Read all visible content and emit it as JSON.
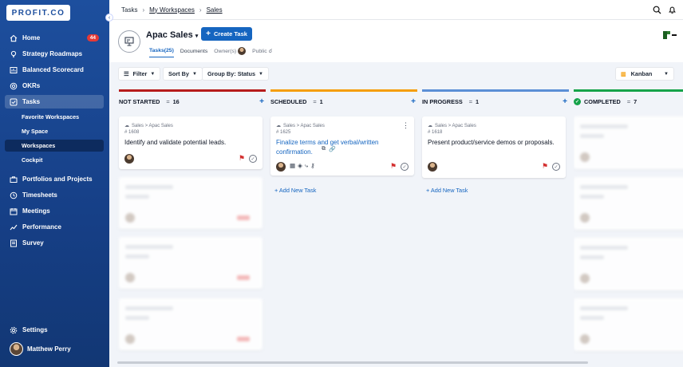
{
  "sidebar": {
    "logo": "PROFIT.CO",
    "items": [
      {
        "label": "Home",
        "icon": "home-icon",
        "badge": "44"
      },
      {
        "label": "Strategy Roadmaps",
        "icon": "bulb-icon"
      },
      {
        "label": "Balanced Scorecard",
        "icon": "scorecard-icon"
      },
      {
        "label": "OKRs",
        "icon": "target-icon"
      },
      {
        "label": "Tasks",
        "icon": "checkbox-icon"
      },
      {
        "label": "Portfolios and Projects",
        "icon": "briefcase-icon"
      },
      {
        "label": "Timesheets",
        "icon": "clock-icon"
      },
      {
        "label": "Meetings",
        "icon": "calendar-icon"
      },
      {
        "label": "Performance",
        "icon": "performance-icon"
      },
      {
        "label": "Survey",
        "icon": "survey-icon"
      }
    ],
    "sub_items": [
      {
        "label": "Favorite Workspaces"
      },
      {
        "label": "My Space"
      },
      {
        "label": "Workspaces"
      },
      {
        "label": "Cockpit"
      }
    ],
    "settings_label": "Settings",
    "user_name": "Matthew Perry"
  },
  "breadcrumb": {
    "root": "Tasks",
    "middle": "My Workspaces",
    "current": "Sales"
  },
  "header": {
    "title": "Apac Sales",
    "create_label": "Create Task",
    "tabs": {
      "tasks": "Tasks(25)",
      "documents": "Documents",
      "owners": "Owner(s)",
      "visibility": "Public"
    }
  },
  "toolbar": {
    "filter": "Filter",
    "sort": "Sort By",
    "group": "Group By: Status",
    "view": "Kanban"
  },
  "columns": [
    {
      "name": "NOT STARTED",
      "count": "16",
      "color": "#b71c1c"
    },
    {
      "name": "SCHEDULED",
      "count": "1",
      "color": "#f59e0b"
    },
    {
      "name": "IN PROGRESS",
      "count": "1",
      "color": "#5b8fd6"
    },
    {
      "name": "COMPLETED",
      "count": "7",
      "color": "#16a34a"
    }
  ],
  "cards": [
    {
      "crumb": "Sales > Apac Sales",
      "id": "# 1608",
      "title": "Identify and validate potential leads."
    },
    {
      "crumb": "Sales > Apac Sales",
      "id": "# 1625",
      "title": "Finalize terms and get verbal/written confirmation."
    },
    {
      "crumb": "Sales > Apac Sales",
      "id": "# 1618",
      "title": "Present product/service demos or proposals."
    }
  ],
  "add_task_label": "Add New Task"
}
